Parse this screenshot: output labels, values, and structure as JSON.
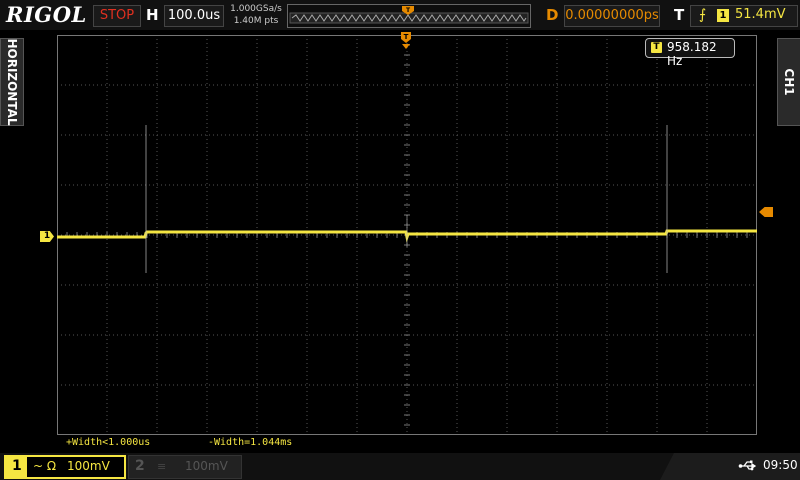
{
  "header": {
    "brand": "RIGOL",
    "run_status": "STOP",
    "horizontal_label": "H",
    "timebase": "100.0us",
    "sample_rate": "1.000GSa/s",
    "memory_depth": "1.40M pts",
    "delay_label": "D",
    "delay": "0.00000000ps",
    "trigger_label": "T",
    "trigger_source": "1",
    "trigger_level": "51.4mV"
  },
  "side_tabs": {
    "left": "HORIZONTAL",
    "right": "CH1"
  },
  "frequency_counter": {
    "icon_label": "T",
    "value": "958.182 Hz"
  },
  "channel_marker": "1",
  "measurements": {
    "positive_width": "+Width<1.000us",
    "negative_width": "-Width=1.044ms"
  },
  "bottom": {
    "ch1": {
      "number": "1",
      "coupling": "~ Ω",
      "scale": "100mV"
    },
    "ch2": {
      "number": "2",
      "coupling": "≡",
      "scale": "100mV"
    },
    "time": "09:50"
  },
  "colors": {
    "ch1": "#f5e642",
    "trigger": "#e68a00",
    "stop": "#e03020",
    "background": "#000000",
    "grid": "#555555"
  },
  "icons": [
    "usb-icon",
    "rising-edge-icon",
    "trigger-position-marker",
    "trigger-level-marker"
  ]
}
